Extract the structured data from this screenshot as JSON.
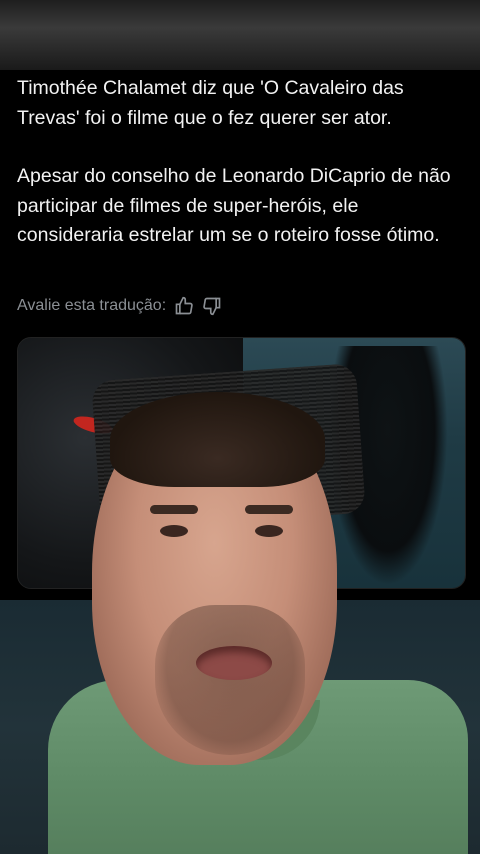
{
  "post": {
    "paragraph1": "Timothée Chalamet diz que 'O Cavaleiro das Trevas' foi o filme que o fez querer ser ator.",
    "paragraph2": "Apesar do conselho de Leonardo DiCaprio de não participar de filmes de super-heróis, ele consideraria estrelar um se o roteiro fosse ótimo."
  },
  "translation_rating": {
    "label": "Avalie esta tradução:",
    "icons": [
      "thumbs-up-icon",
      "thumbs-down-icon"
    ]
  },
  "colors": {
    "background": "#000000",
    "text": "#f2f2f2",
    "muted": "#8b8f94",
    "shirt": "#6e9a76"
  }
}
